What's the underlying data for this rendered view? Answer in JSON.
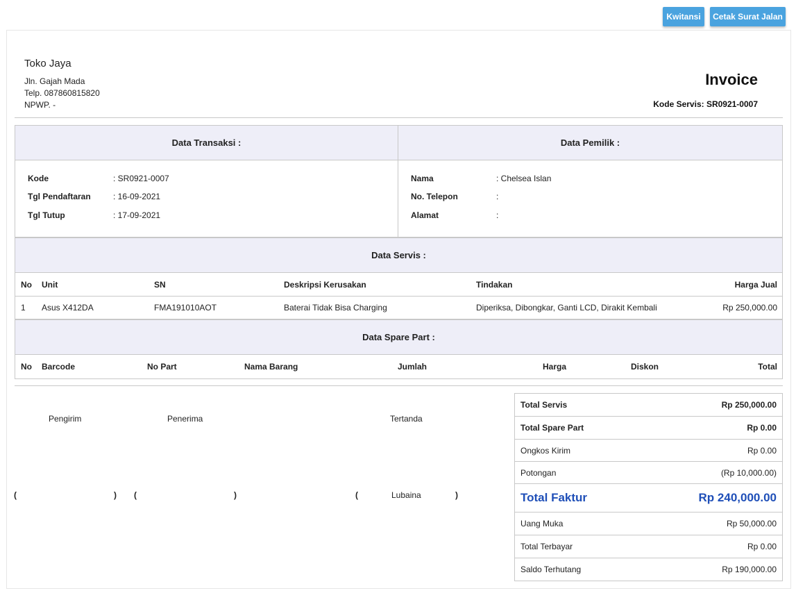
{
  "toolbar": {
    "kwitansi_label": "Kwitansi",
    "surat_jalan_label": "Cetak Surat Jalan"
  },
  "shop": {
    "name": "Toko Jaya",
    "address": "Jln. Gajah Mada",
    "phone": "Telp. 087860815820",
    "npwp": "NPWP. -"
  },
  "invoice": {
    "title": "Invoice",
    "kode_servis": "Kode Servis: SR0921-0007"
  },
  "transaksi": {
    "header": "Data Transaksi :",
    "rows": [
      {
        "label": "Kode",
        "value": ": SR0921-0007"
      },
      {
        "label": "Tgl Pendaftaran",
        "value": ": 16-09-2021"
      },
      {
        "label": "Tgl Tutup",
        "value": ": 17-09-2021"
      }
    ]
  },
  "pemilik": {
    "header": "Data Pemilik :",
    "rows": [
      {
        "label": "Nama",
        "value": ": Chelsea Islan"
      },
      {
        "label": "No. Telepon",
        "value": ":"
      },
      {
        "label": "Alamat",
        "value": ":"
      }
    ]
  },
  "servis": {
    "header": "Data Servis :",
    "columns": [
      "No",
      "Unit",
      "SN",
      "Deskripsi Kerusakan",
      "Tindakan",
      "Harga Jual"
    ],
    "rows": [
      [
        "1",
        "Asus X412DA",
        "FMA191010AOT",
        "Baterai Tidak Bisa Charging",
        "Diperiksa, Dibongkar, Ganti LCD, Dirakit Kembali",
        "Rp 250,000.00"
      ]
    ]
  },
  "sparepart": {
    "header": "Data Spare Part :",
    "columns": [
      "No",
      "Barcode",
      "No Part",
      "Nama Barang",
      "Jumlah",
      "Harga",
      "Diskon",
      "Total"
    ]
  },
  "signatures": {
    "pengirim": "Pengirim",
    "penerima": "Penerima",
    "tertanda": "Tertanda",
    "tertanda_name": "Lubaina",
    "open": "(",
    "close": ")"
  },
  "summary": [
    {
      "label": "Total Servis",
      "value": "Rp 250,000.00"
    },
    {
      "label": "Total Spare Part",
      "value": "Rp 0.00"
    },
    {
      "label": "Ongkos Kirim",
      "value": "Rp 0.00"
    },
    {
      "label": "Potongan",
      "value": "(Rp 10,000.00)"
    },
    {
      "label": "Total Faktur",
      "value": "Rp 240,000.00"
    },
    {
      "label": "Uang Muka",
      "value": "Rp 50,000.00"
    },
    {
      "label": "Total Terbayar",
      "value": "Rp 0.00"
    },
    {
      "label": "Saldo Terhutang",
      "value": "Rp 190,000.00"
    }
  ],
  "colors": {
    "button": "#4aa3df",
    "header_bg": "#eeeef8",
    "total_faktur": "#1f4fb8"
  }
}
